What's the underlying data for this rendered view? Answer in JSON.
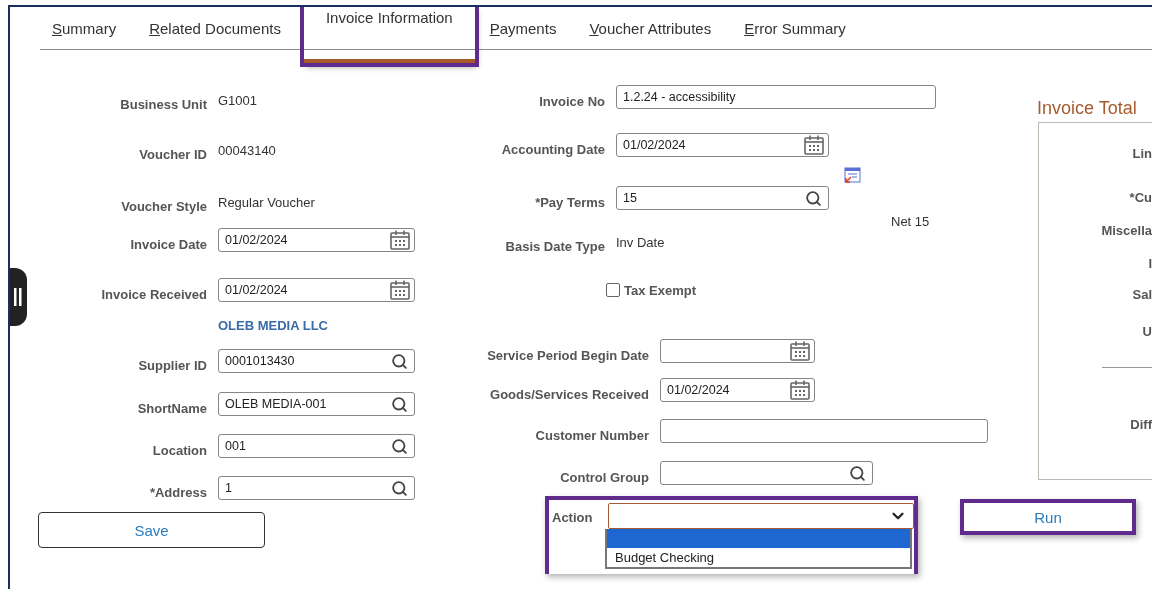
{
  "tabs": [
    {
      "label": "Summary",
      "selected": false,
      "hotkey": true
    },
    {
      "label": "Related Documents",
      "selected": false,
      "hotkey": true
    },
    {
      "label": "Invoice Information",
      "selected": true,
      "hotkey": false,
      "highlighted": true
    },
    {
      "label": "Payments",
      "selected": false,
      "hotkey": true
    },
    {
      "label": "Voucher Attributes",
      "selected": false,
      "hotkey": true
    },
    {
      "label": "Error Summary",
      "selected": false,
      "hotkey": true
    }
  ],
  "left_fields": [
    {
      "kind": "text",
      "label": "Business Unit",
      "value": "G1001"
    },
    {
      "kind": "text",
      "label": "Voucher ID",
      "value": "00043140"
    },
    {
      "kind": "text",
      "label": "Voucher Style",
      "value": "Regular Voucher"
    },
    {
      "kind": "date",
      "label": "Invoice Date",
      "value": "01/02/2024"
    },
    {
      "kind": "date",
      "label": "Invoice Received",
      "value": "01/02/2024"
    },
    {
      "kind": "name",
      "value": "OLEB MEDIA LLC"
    },
    {
      "kind": "lookup",
      "label": "Supplier ID",
      "value": "0001013430"
    },
    {
      "kind": "lookup",
      "label": "ShortName",
      "value": "OLEB MEDIA-001"
    },
    {
      "kind": "lookup",
      "label": "Location",
      "value": "001"
    },
    {
      "kind": "lookup",
      "label": "*Address",
      "value": "1"
    }
  ],
  "save_button": "Save",
  "middle_upper": [
    {
      "kind": "input",
      "label": "Invoice No",
      "value": "1.2.24 - accessibility"
    },
    {
      "kind": "date",
      "label": "Accounting Date",
      "value": "01/02/2024",
      "link_icon": true
    },
    {
      "kind": "lookup",
      "label": "*Pay Terms",
      "value": "15",
      "description": "Net 15"
    },
    {
      "kind": "text",
      "label": "Basis Date Type",
      "value": "Inv Date"
    },
    {
      "kind": "checkbox",
      "label": "Tax Exempt",
      "checked": false
    }
  ],
  "middle_lower": [
    {
      "kind": "date",
      "label": "Service Period Begin Date"
    },
    {
      "kind": "date",
      "label": "Goods/Services Received",
      "value": "01/02/2024"
    },
    {
      "kind": "input",
      "label": "Customer Number"
    },
    {
      "kind": "lookup",
      "label": "Control Group"
    }
  ],
  "action": {
    "label": "Action",
    "highlighted": true,
    "expanded": true,
    "options": [
      {
        "kind": "blank",
        "selected": true
      },
      {
        "kind": "text",
        "label": "Budget Checking",
        "selected": false
      }
    ]
  },
  "run_button": {
    "label": "Run",
    "highlighted": true
  },
  "invoice_total": {
    "title": "Invoice Total",
    "rows": [
      {
        "kind": "label",
        "label": "Lin"
      },
      {
        "kind": "label",
        "label": "*Cu"
      },
      {
        "kind": "label",
        "label": "Miscella"
      },
      {
        "kind": "label",
        "label": "I"
      },
      {
        "kind": "label",
        "label": "Sal"
      },
      {
        "kind": "label",
        "label": "U"
      },
      {
        "kind": "rule"
      },
      {
        "kind": "label",
        "label": "Diff"
      }
    ]
  }
}
